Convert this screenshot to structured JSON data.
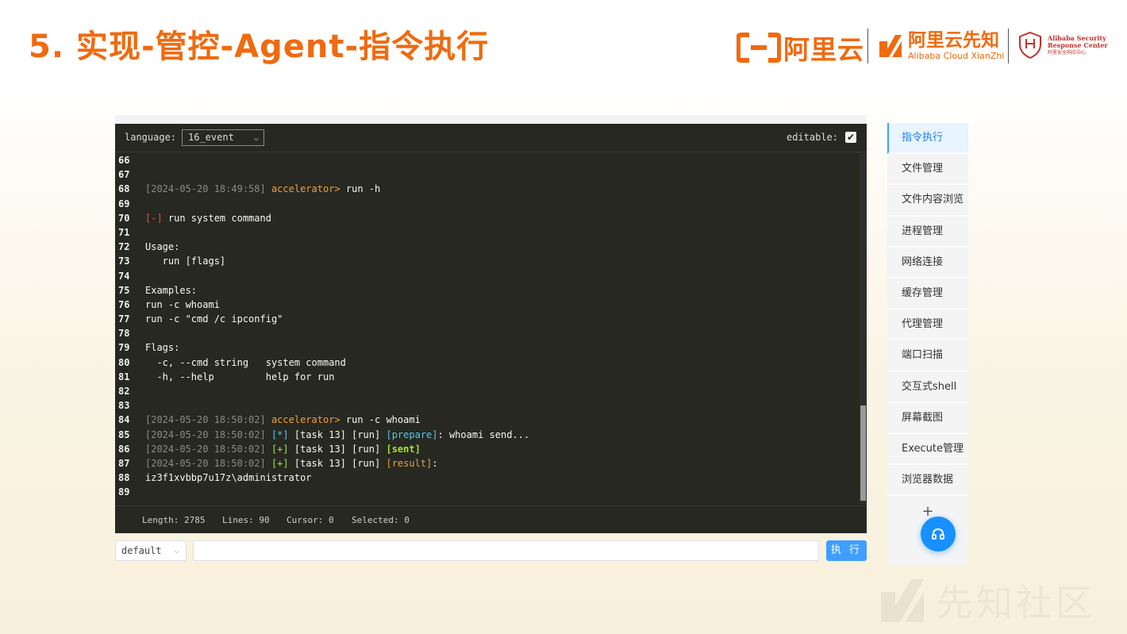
{
  "slide": {
    "title": "5. 实现-管控-Agent-指令执行"
  },
  "logos": {
    "aliyun": "阿里云",
    "xianzhi_cn": "阿里云先知",
    "xianzhi_en": "Alibaba Cloud XianZhi",
    "asrc_line1": "Alibaba Security",
    "asrc_line2": "Response Center",
    "asrc_line3": "阿里安全响应中心"
  },
  "colors": {
    "accent": "#f06a0f",
    "primary": "#409eff",
    "editor_bg": "#272822"
  },
  "editor": {
    "language_label": "language:",
    "language_value": "16_event",
    "editable_label": "editable:",
    "checkbox_mark": "✔",
    "lines": [
      {
        "n": "66",
        "parts": []
      },
      {
        "n": "67",
        "parts": []
      },
      {
        "n": "68",
        "parts": [
          {
            "t": "[2024-05-20 18:49:58] ",
            "c": "gray"
          },
          {
            "t": "accelerator> ",
            "c": "orange"
          },
          {
            "t": "run -h",
            "c": "white"
          }
        ]
      },
      {
        "n": "69",
        "parts": []
      },
      {
        "n": "70",
        "parts": [
          {
            "t": "[-]",
            "c": "red"
          },
          {
            "t": " run system command",
            "c": "white"
          }
        ]
      },
      {
        "n": "71",
        "parts": []
      },
      {
        "n": "72",
        "parts": [
          {
            "t": "Usage:",
            "c": "white"
          }
        ]
      },
      {
        "n": "73",
        "parts": [
          {
            "t": "   run [flags]",
            "c": "white"
          }
        ]
      },
      {
        "n": "74",
        "parts": []
      },
      {
        "n": "75",
        "parts": [
          {
            "t": "Examples:",
            "c": "white"
          }
        ]
      },
      {
        "n": "76",
        "parts": [
          {
            "t": "run -c whoami",
            "c": "white"
          }
        ]
      },
      {
        "n": "77",
        "parts": [
          {
            "t": "run -c \"cmd /c ipconfig\"",
            "c": "white"
          }
        ]
      },
      {
        "n": "78",
        "parts": []
      },
      {
        "n": "79",
        "parts": [
          {
            "t": "Flags:",
            "c": "white"
          }
        ]
      },
      {
        "n": "80",
        "parts": [
          {
            "t": "  -c, --cmd string   system command",
            "c": "white"
          }
        ]
      },
      {
        "n": "81",
        "parts": [
          {
            "t": "  -h, --help         help for run",
            "c": "white"
          }
        ]
      },
      {
        "n": "82",
        "parts": []
      },
      {
        "n": "83",
        "parts": []
      },
      {
        "n": "84",
        "parts": [
          {
            "t": "[2024-05-20 18:50:02] ",
            "c": "gray"
          },
          {
            "t": "accelerator> ",
            "c": "orange"
          },
          {
            "t": "run -c whoami",
            "c": "white"
          }
        ]
      },
      {
        "n": "85",
        "parts": [
          {
            "t": "[2024-05-20 18:50:02] ",
            "c": "gray"
          },
          {
            "t": "[*]",
            "c": "cyan"
          },
          {
            "t": " [task 13] [run] ",
            "c": "white"
          },
          {
            "t": "[prepare]",
            "c": "cyan"
          },
          {
            "t": ": whoami send...",
            "c": "white"
          }
        ]
      },
      {
        "n": "86",
        "parts": [
          {
            "t": "[2024-05-20 18:50:02] ",
            "c": "gray"
          },
          {
            "t": "[+]",
            "c": "green"
          },
          {
            "t": " [task 13] [run] ",
            "c": "white"
          },
          {
            "t": "[sent]",
            "c": "greenb"
          }
        ]
      },
      {
        "n": "87",
        "parts": [
          {
            "t": "[2024-05-20 18:50:02] ",
            "c": "gray"
          },
          {
            "t": "[+]",
            "c": "green"
          },
          {
            "t": " [task 13] [run] ",
            "c": "white"
          },
          {
            "t": "[result]",
            "c": "gold"
          },
          {
            "t": ":",
            "c": "white"
          }
        ]
      },
      {
        "n": "88",
        "parts": [
          {
            "t": "iz3f1xvbbp7u17z\\administrator",
            "c": "white"
          }
        ]
      },
      {
        "n": "89",
        "parts": []
      }
    ],
    "status": {
      "length": "Length: 2785",
      "lines": "Lines: 90",
      "cursor": "Cursor: 0",
      "selected": "Selected: 0"
    }
  },
  "command_bar": {
    "mode": "default",
    "input_value": "",
    "run_label": "执 行"
  },
  "side_menu": {
    "items": [
      "指令执行",
      "文件管理",
      "文件内容浏览",
      "进程管理",
      "网络连接",
      "缓存管理",
      "代理管理",
      "端口扫描",
      "交互式shell",
      "屏幕截图",
      "Execute管理",
      "浏览器数据"
    ],
    "active_index": 0,
    "add_label": "+"
  },
  "watermark": {
    "text": "先知社区"
  }
}
